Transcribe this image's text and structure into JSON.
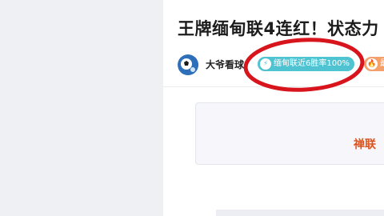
{
  "article": {
    "title": "王牌缅甸联4连红！状态力",
    "author": {
      "name": "大爷看球",
      "avatar_icon": "football-avatar-icon"
    },
    "tags": [
      {
        "label": "缅甸联近6胜率100%",
        "icon": "lightning-icon",
        "color": "#4fc3d2"
      },
      {
        "label": "最",
        "icon": "flame-icon",
        "color": "#f4a06a"
      }
    ],
    "preview_text": "禅联"
  },
  "annotation": {
    "shape": "ellipse",
    "color": "#d8141c"
  }
}
